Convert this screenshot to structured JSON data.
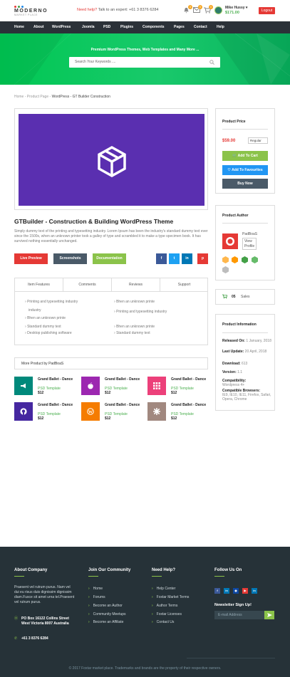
{
  "header": {
    "logo_text": "MODERNO",
    "logo_sub": "MARKET PLACE",
    "help_label": "Need help?",
    "help_text": "Talk to an expert: +61 3 8376 6284",
    "badges": [
      "3",
      "0",
      "0"
    ],
    "username": "Mike Hussy",
    "balance": "$171.00",
    "logout": "Logout"
  },
  "nav": [
    "Home",
    "About",
    "WordPress",
    "Joomla",
    "PSD",
    "Plugins",
    "Components",
    "Pages",
    "Contact",
    "Help"
  ],
  "hero": {
    "tagline": "Premium WordPress Themes, Web Templates and Many More ...",
    "search_placeholder": "Search Your Keywords ...."
  },
  "breadcrumb": {
    "home": "Home",
    "sep": "-",
    "section": "Product Page",
    "current": "WordPress - GT Builder Construction"
  },
  "product": {
    "title": "GTBuilder - Construction & Building WordPress Theme",
    "description": "Simply dummy text of the printing and typesetting industry. Lorem Ipsum has been the industry's standard dummy text ever since the 1500s, when an unknown printer took a galley of type and scrambled it to make a type specimen book. It has survived nothing essentially unchanged.",
    "buttons": {
      "preview": "Live Preview",
      "screenshots": "Screenshots",
      "documentation": "Documentation"
    },
    "social": [
      "f",
      "t",
      "in",
      "p"
    ],
    "tabs": [
      "Item Features",
      "Comments",
      "Reviews",
      "Support"
    ],
    "features_left": [
      "Printing and typesetting industry",
      "Bhen an unknown printe",
      "Standard dummy text",
      "Desktop publishing software"
    ],
    "features_right": [
      "Bhen an unknown printe",
      "Printing and typesetting industry",
      "Bhen an unknown printe",
      "Standard dummy text"
    ]
  },
  "more_products": {
    "title": "More Product by PadBoaS",
    "items": [
      {
        "name": "Grand Ballet - Dance",
        "type": "PSD Template",
        "price": "$12",
        "color": "#00897b",
        "icon": "megaphone-icon"
      },
      {
        "name": "Grand Ballet - Dance",
        "type": "PSD Template",
        "price": "$12",
        "color": "#9c27b0",
        "icon": "apple-icon"
      },
      {
        "name": "Grand Ballet - Dance",
        "type": "PSD Template",
        "price": "$12",
        "color": "#ec407a",
        "icon": "grid-icon"
      },
      {
        "name": "Grand Ballet - Dance",
        "type": "PSD Template",
        "price": "$12",
        "color": "#4527a0",
        "icon": "github-icon"
      },
      {
        "name": "Grand Ballet - Dance",
        "type": "PSD Template",
        "price": "$12",
        "color": "#f57c00",
        "icon": "wordpress-icon"
      },
      {
        "name": "Grand Ballet - Dance",
        "type": "PSD Template",
        "price": "$12",
        "color": "#a1887f",
        "icon": "joomla-icon"
      }
    ]
  },
  "price_box": {
    "title": "Product Price",
    "price": "$59.00",
    "license": "Regular",
    "add_to_cart": "Add To Cart",
    "add_to_fav": "Add To Favourites",
    "buy_now": "Buy Now"
  },
  "author": {
    "title": "Product Author",
    "name": "PadBoaS",
    "view_profile": "View Profile"
  },
  "sales": {
    "count": "05",
    "label": "Sales"
  },
  "info": {
    "title": "Product Information",
    "released_label": "Released On:",
    "released": "1 January, 2018",
    "updated_label": "Last Update:",
    "updated": "20 April, 2018",
    "downloads_label": "Download:",
    "downloads": "613",
    "version_label": "Version:",
    "version": "1.1",
    "compat_label": "Compatibility:",
    "compat": "Wordpress 4+",
    "browsers_label": "Compatible Browsers:",
    "browsers": "IE9, IE10, IE11, Firefox, Safari, Opera, Chrome"
  },
  "footer": {
    "about_title": "About Company",
    "about_text": "Praesent vel rutrum purus. Nam vel dui eu risus duis dignissim dignissim diam.Fusce sit amet urna tel.Praesent vel rutrum purus.",
    "address": "PO Box 16122 Collins Street West Victoria 8007 Australia",
    "phone": "+61 3 8376 6284",
    "community_title": "Join Our Community",
    "community_links": [
      "Home",
      "Forums",
      "Become an Author",
      "Community Meetups",
      "Become an Affiliate"
    ],
    "help_title": "Need Help?",
    "help_links": [
      "Help Center",
      "Foxtar Market Terms",
      "Author Terms",
      "Foxtar Licenses",
      "Contact Us"
    ],
    "follow_title": "Follow Us On",
    "social": [
      "f",
      "in",
      "◉",
      "▶",
      "in"
    ],
    "newsletter_title": "Newsletter Sign Up!",
    "email_placeholder": "E-mail Address",
    "copyright": "© 2017 Foxtar market place. Trademarks and brands are the property of their respective owners."
  }
}
